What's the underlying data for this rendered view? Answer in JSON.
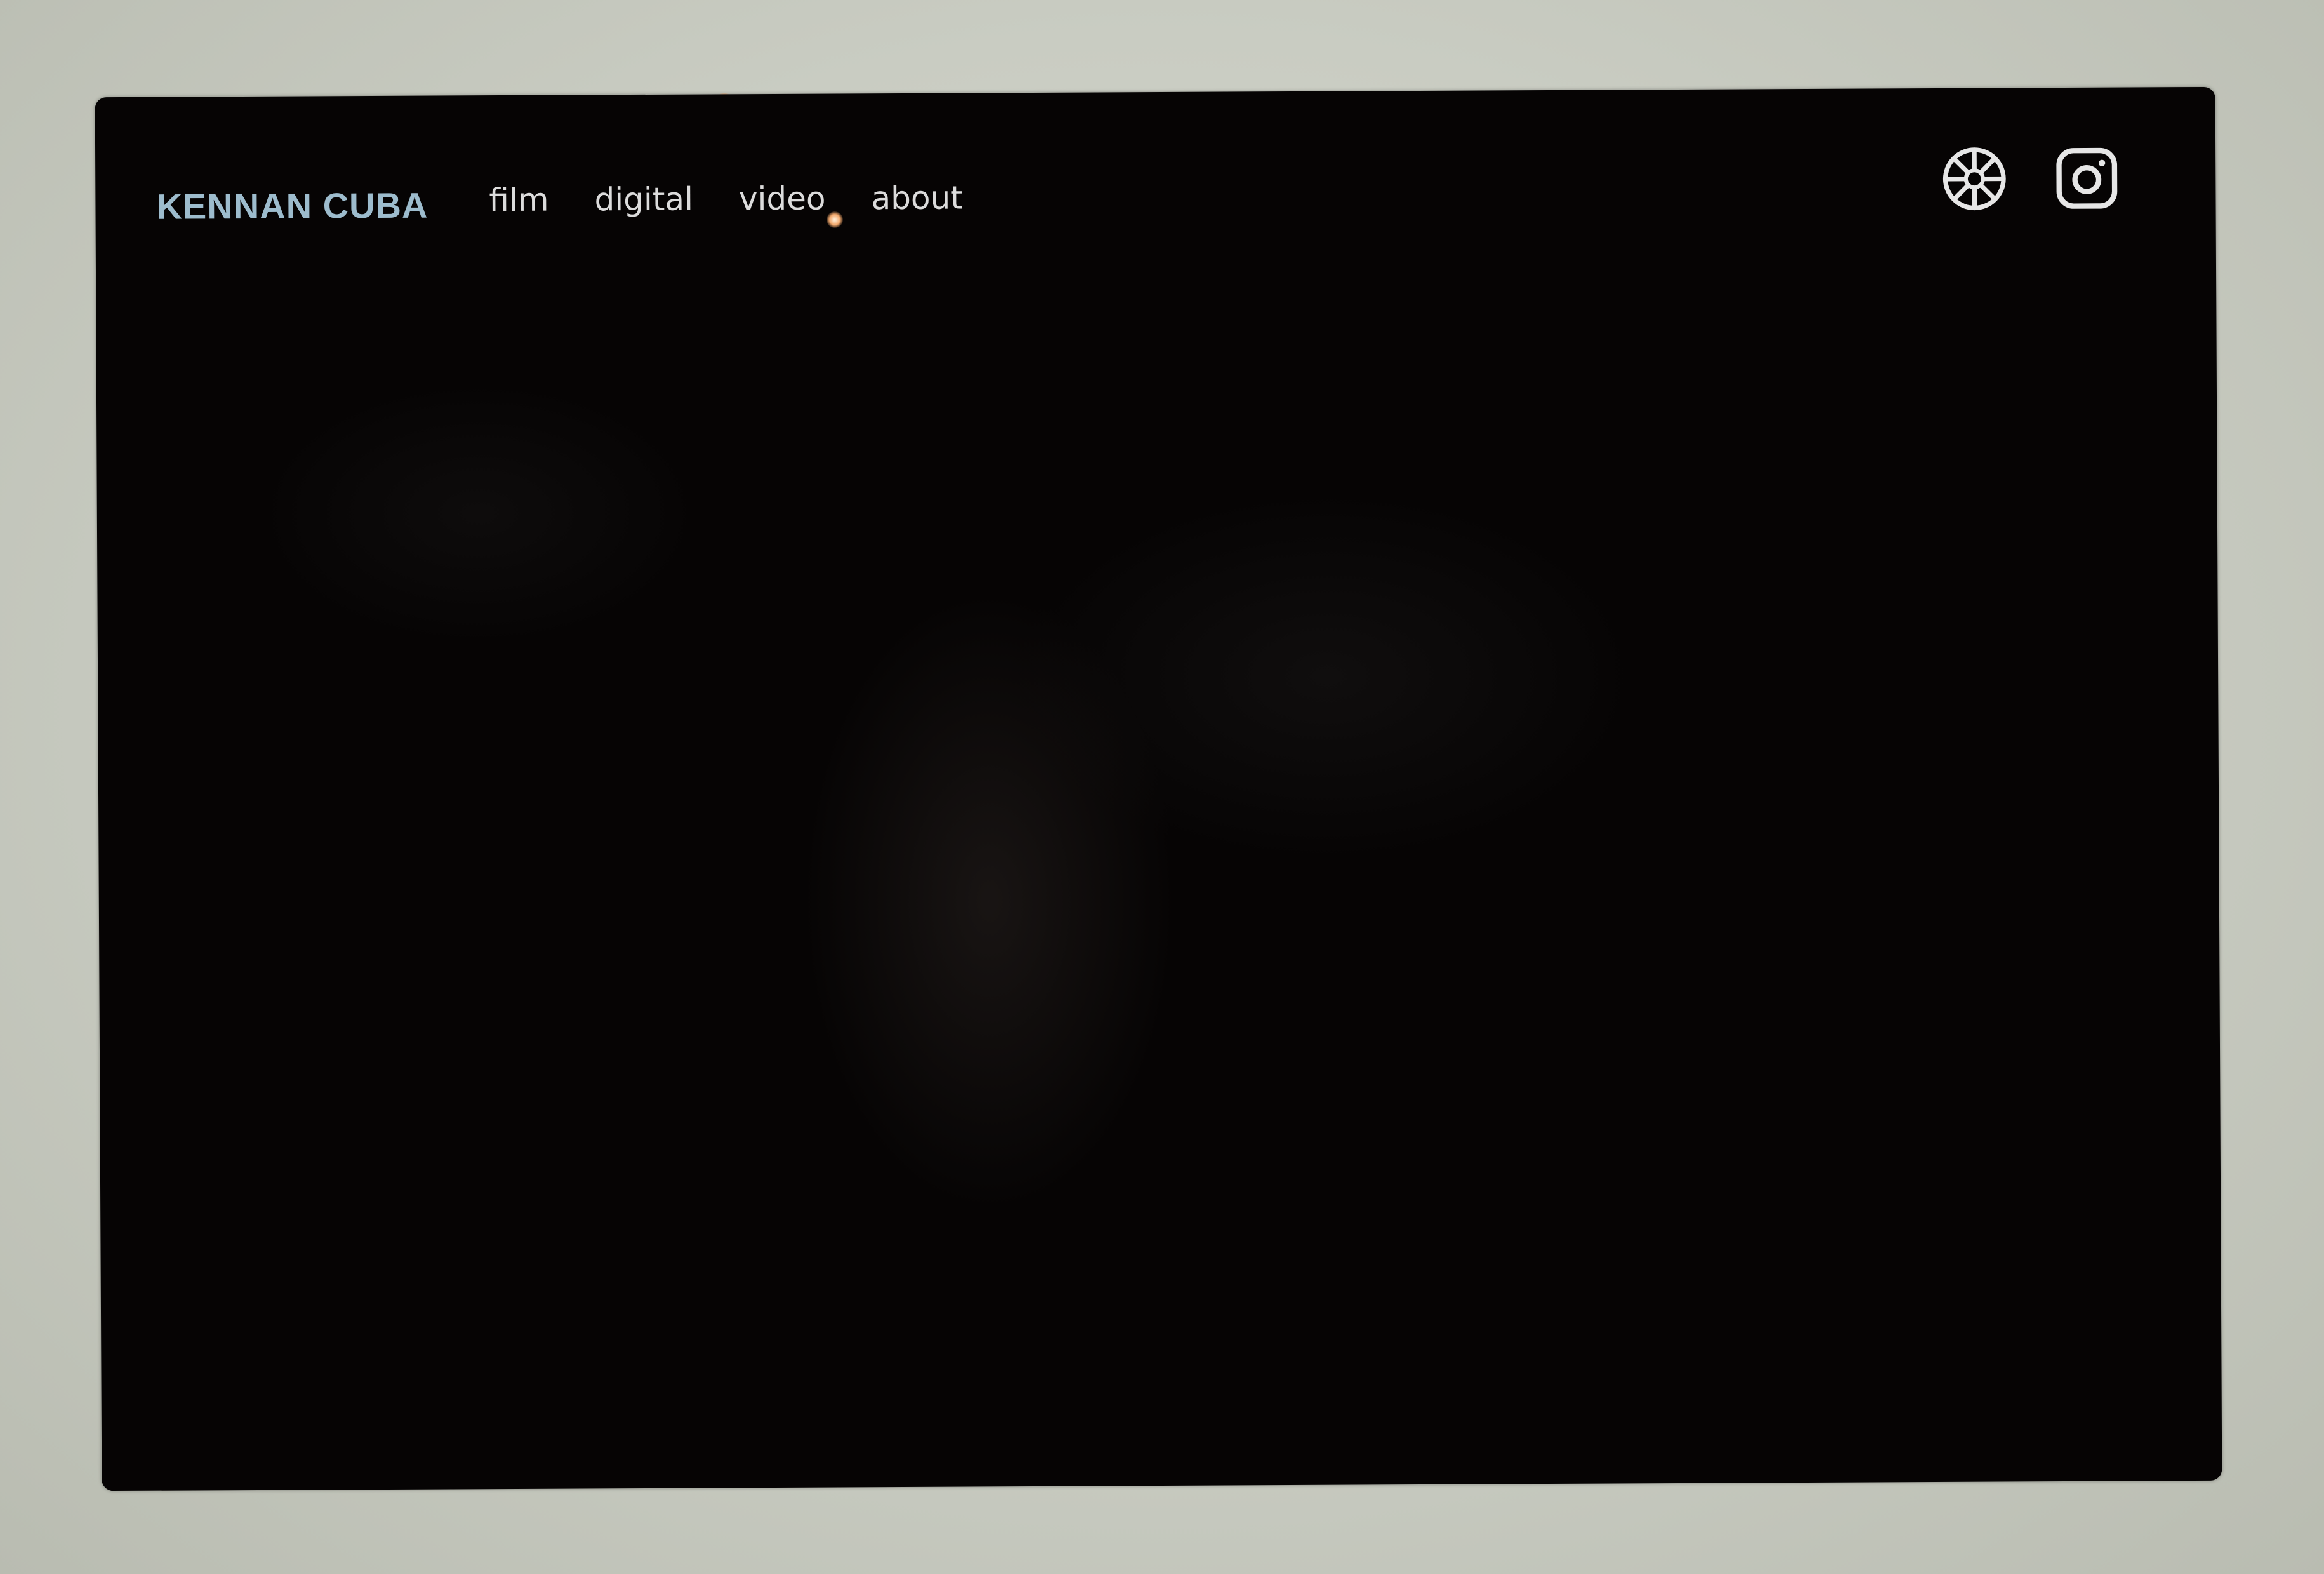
{
  "site": {
    "brand": "KENNAN CUBA"
  },
  "nav": {
    "items": [
      {
        "label": "film"
      },
      {
        "label": "digital"
      },
      {
        "label": "video"
      },
      {
        "label": "about"
      }
    ]
  },
  "social": {
    "icons": [
      "aperture-icon",
      "instagram-icon"
    ]
  },
  "colors": {
    "brand": "#9dbccd",
    "nav_text": "#dcdcdc",
    "screen_background": "#060404",
    "surround": "#c9ccc2"
  }
}
